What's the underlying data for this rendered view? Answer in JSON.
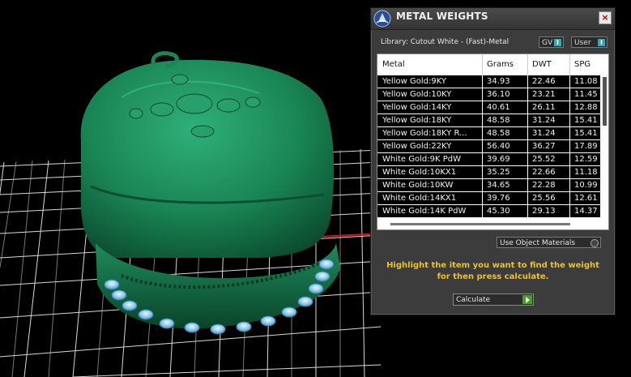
{
  "dialog": {
    "title": "METAL WEIGHTS",
    "close_label": "×",
    "library_label": "Library: Cutout White - (Fast)-Metal",
    "toggles": [
      {
        "label": "GV",
        "state": "I"
      },
      {
        "label": "User",
        "state": "I"
      }
    ],
    "table": {
      "headers": [
        "Metal",
        "Grams",
        "DWT",
        "SPG"
      ],
      "rows": [
        [
          "Yellow Gold:9KY",
          "34.93",
          "22.46",
          "11.08"
        ],
        [
          "Yellow Gold:10KY",
          "36.10",
          "23.21",
          "11.45"
        ],
        [
          "Yellow Gold:14KY",
          "40.61",
          "26.11",
          "12.88"
        ],
        [
          "Yellow Gold:18KY",
          "48.58",
          "31.24",
          "15.41"
        ],
        [
          "Yellow Gold:18KY R...",
          "48.58",
          "31.24",
          "15.41"
        ],
        [
          "Yellow Gold:22KY",
          "56.40",
          "36.27",
          "17.89"
        ],
        [
          "White Gold:9K PdW",
          "39.69",
          "25.52",
          "12.59"
        ],
        [
          "White Gold:10KX1",
          "35.25",
          "22.66",
          "11.18"
        ],
        [
          "White Gold:10KW",
          "34.65",
          "22.28",
          "10.99"
        ],
        [
          "White Gold:14KX1",
          "39.76",
          "25.56",
          "12.61"
        ],
        [
          "White Gold:14K PdW",
          "45.30",
          "29.13",
          "14.37"
        ]
      ]
    },
    "use_object_materials_label": "Use Object Materials",
    "hint_text": "Highlight the item you want to find the weight for then press calculate.",
    "calculate_label": "Calculate"
  },
  "colors": {
    "model_green": "#1f8a5a",
    "grid_line": "#d8d8d8",
    "hint_yellow": "#f1c21b",
    "toggle_accent": "#39a6b6",
    "calculate_arrow": "#4a9b2d"
  },
  "icons": {
    "app_logo": "rhino-logo-icon",
    "close": "close-icon",
    "calculate_arrow": "play-arrow-icon"
  }
}
